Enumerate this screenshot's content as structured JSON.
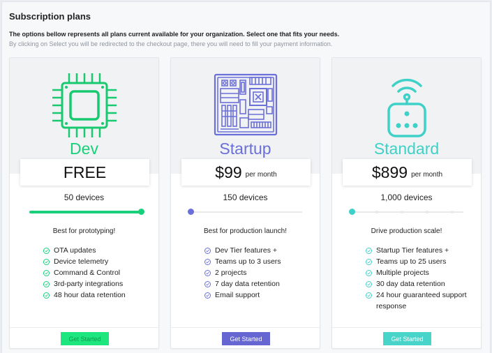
{
  "page": {
    "title": "Subscription plans",
    "lead": "The options bellow represents all plans current available for your organization. Select one that fits your needs.",
    "sub": "By clicking on Select you will be redirected to the checkout page, there you will need to fill your payment information."
  },
  "plans": [
    {
      "name": "Dev",
      "icon": "chip-icon",
      "accent": "#19d07a",
      "price": "FREE",
      "period": "",
      "devices": "50 devices",
      "slider_fraction": 1.0,
      "tagline": "Best for prototyping!",
      "features": [
        "OTA updates",
        "Device telemetry",
        "Command & Control",
        "3rd-party integrations",
        "48 hour data retention"
      ],
      "button": "Get Started",
      "button_color": "#1ee67f",
      "button_text_color": "#0a9a4a"
    },
    {
      "name": "Startup",
      "icon": "motherboard-icon",
      "accent": "#6b6fd9",
      "price": "$99",
      "period": "per month",
      "devices": "150 devices",
      "slider_fraction": 0.0,
      "tagline": "Best for production launch!",
      "features": [
        "Dev Tier features +",
        "Teams up to 3 users",
        "2 projects",
        "7 day data retention",
        "Email support"
      ],
      "button": "Get Started",
      "button_color": "#6566d1",
      "button_text_color": "#ffffff"
    },
    {
      "name": "Standard",
      "icon": "wireless-device-icon",
      "accent": "#3fd1c7",
      "price": "$899",
      "period": "per month",
      "devices": "1,000 devices",
      "slider_fraction": 0.0,
      "tagline": "Drive production scale!",
      "features": [
        "Startup Tier features +",
        "Teams up to 25 users",
        "Multiple projects",
        "30 day data retention",
        "24 hour guaranteed support response"
      ],
      "button": "Get Started",
      "button_color": "#48d4c8",
      "button_text_color": "#ffffff"
    }
  ]
}
